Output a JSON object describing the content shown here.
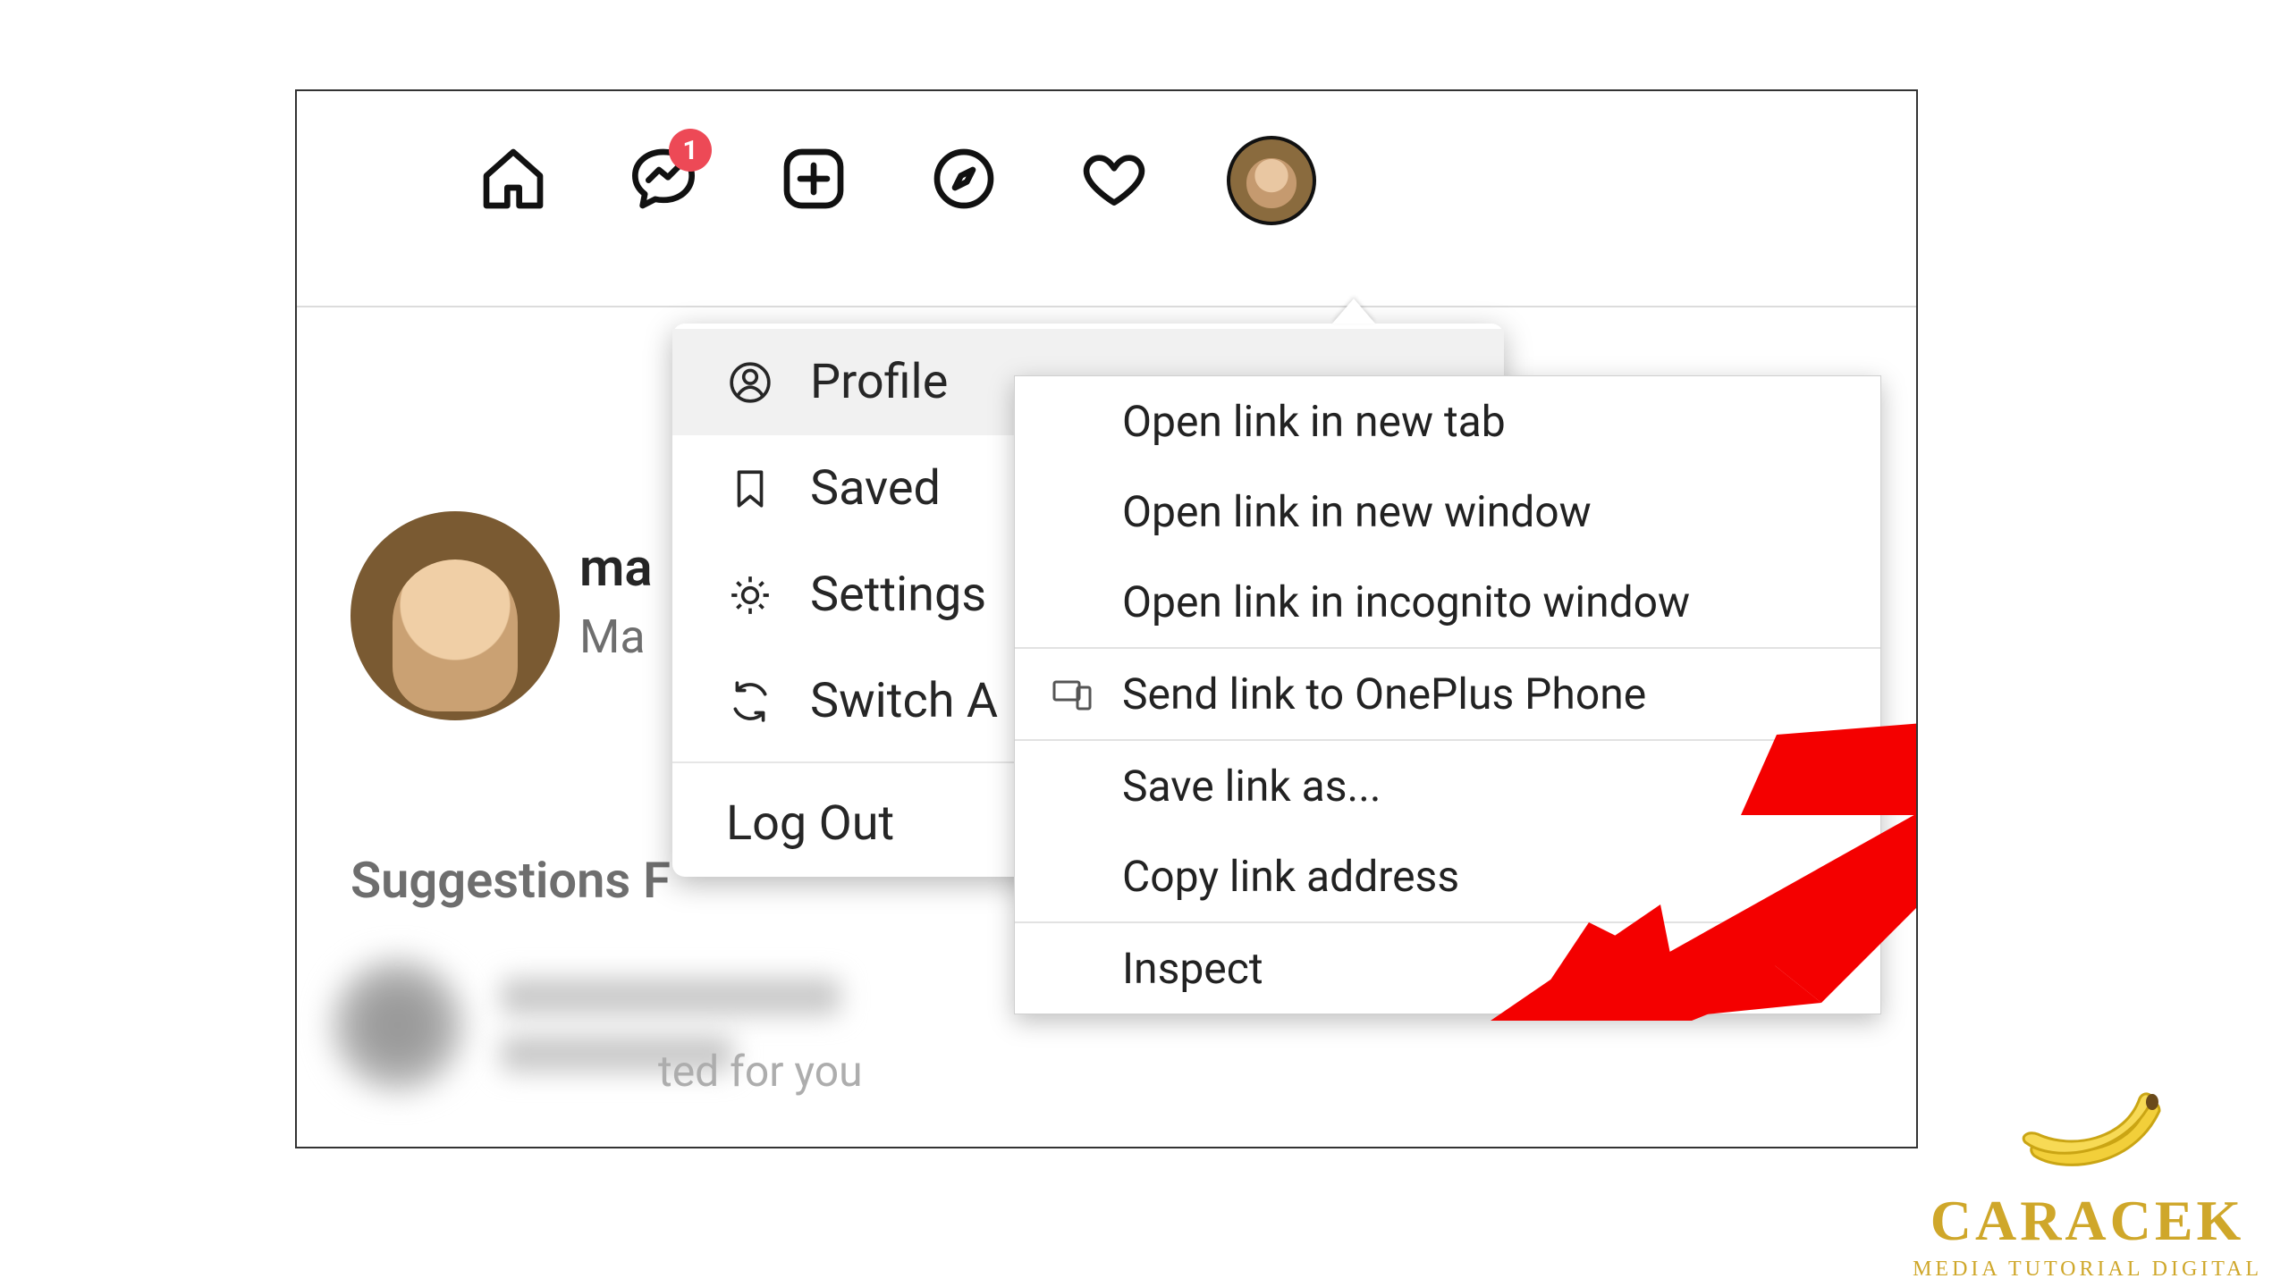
{
  "nav": {
    "messenger_badge": "1"
  },
  "dropdown": {
    "profile": "Profile",
    "saved": "Saved",
    "settings": "Settings",
    "switch": "Switch A",
    "logout": "Log Out"
  },
  "context_menu": {
    "open_tab": "Open link in new tab",
    "open_window": "Open link in new window",
    "open_incognito": "Open link in incognito window",
    "send_device": "Send link to OnePlus Phone",
    "save_as": "Save link as...",
    "copy_link": "Copy link address",
    "inspect": "Inspect"
  },
  "profile_preview": {
    "username_fragment": "ma",
    "displayname_fragment": "Ma"
  },
  "suggestions": {
    "heading": "Suggestions F",
    "tail_text": "ted for you"
  },
  "watermark": {
    "brand": "CARACEK",
    "sub": "MEDIA TUTORIAL DIGITAL"
  }
}
